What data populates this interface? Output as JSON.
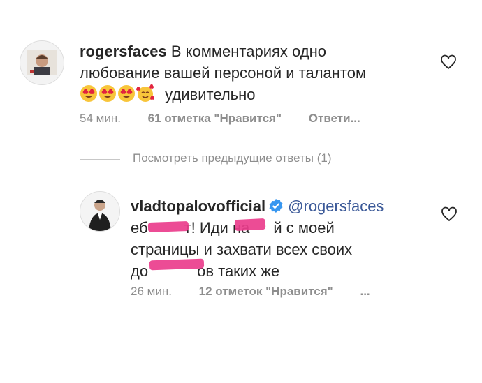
{
  "comment1": {
    "username": "rogersfaces",
    "text_line1": "В комментариях одно",
    "text_line2": "любование вашей персоной и талантом",
    "text_line3": "удивительно",
    "emojis": [
      "heart-eyes",
      "heart-eyes",
      "heart-eyes",
      "smiling-face-with-hearts"
    ],
    "time": "54 мин.",
    "likes": "61 отметка \"Нравится\"",
    "reply": "Ответи..."
  },
  "view_previous_replies": "Посмотреть предыдущие ответы (1)",
  "comment2": {
    "username": "vladtopalovofficial",
    "mention": "@rogersfaces",
    "text_line1_a": "еб",
    "text_line1_b": "т! Иди на",
    "text_line1_c": "й с моей",
    "text_line2": "страницы и захвати всех своих",
    "text_line3_a": "до",
    "text_line3_b": "ов таких же",
    "time": "26 мин.",
    "likes": "12 отметок \"Нравится\"",
    "more": "..."
  },
  "colors": {
    "text": "#262626",
    "meta": "#8e8e8e",
    "mention": "#3b5998",
    "verified": "#3897f0",
    "censor": "#ea3d8c"
  }
}
